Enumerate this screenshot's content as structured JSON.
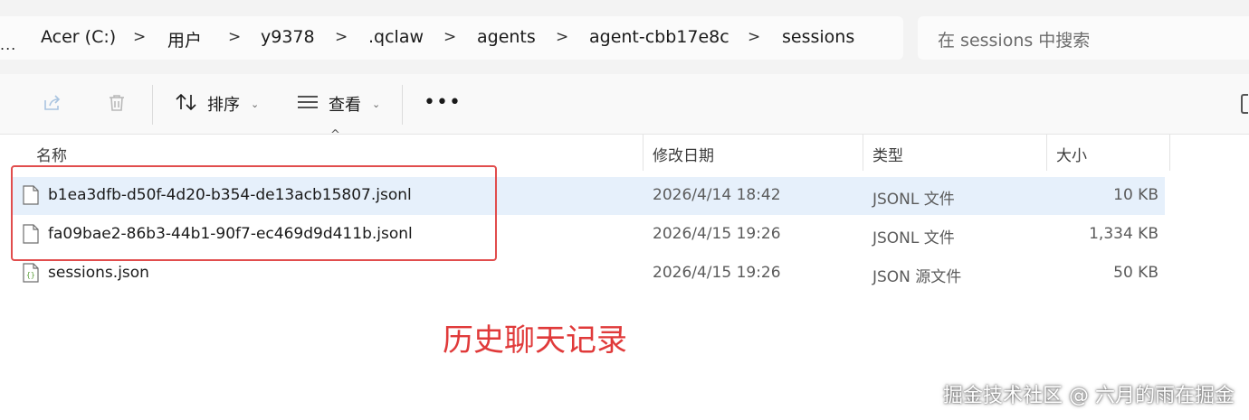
{
  "address_bar": {
    "overflow": "...",
    "crumbs": [
      "Acer (C:)",
      "用户",
      "y9378",
      ".qclaw",
      "agents",
      "agent-cbb17e8c",
      "sessions"
    ],
    "separator": ">"
  },
  "search": {
    "placeholder": "在 sessions 中搜索"
  },
  "toolbar": {
    "share_icon": "share-icon",
    "delete_icon": "trash-icon",
    "sort_label": "排序",
    "view_label": "查看",
    "more_label": "•••"
  },
  "columns": {
    "name": "名称",
    "date": "修改日期",
    "type": "类型",
    "size": "大小"
  },
  "sort_indicator": "^",
  "files": [
    {
      "name": "b1ea3dfb-d50f-4d20-b354-de13acb15807.jsonl",
      "date": "2026/4/14 18:42",
      "type": "JSONL 文件",
      "size": "10 KB",
      "icon": "file-icon",
      "selected": true
    },
    {
      "name": "fa09bae2-86b3-44b1-90f7-ec469d9d411b.jsonl",
      "date": "2026/4/15 19:26",
      "type": "JSONL 文件",
      "size": "1,334 KB",
      "icon": "file-icon",
      "selected": false
    },
    {
      "name": "sessions.json",
      "date": "2026/4/15 19:26",
      "type": "JSON 源文件",
      "size": "50 KB",
      "icon": "json-file-icon",
      "selected": false
    }
  ],
  "annotation": "历史聊天记录",
  "watermark": "掘金技术社区 @ 六月的雨在掘金",
  "colors": {
    "highlight": "#e14d4d",
    "selection": "#e6f0fb",
    "annotation": "#e03a3a"
  }
}
